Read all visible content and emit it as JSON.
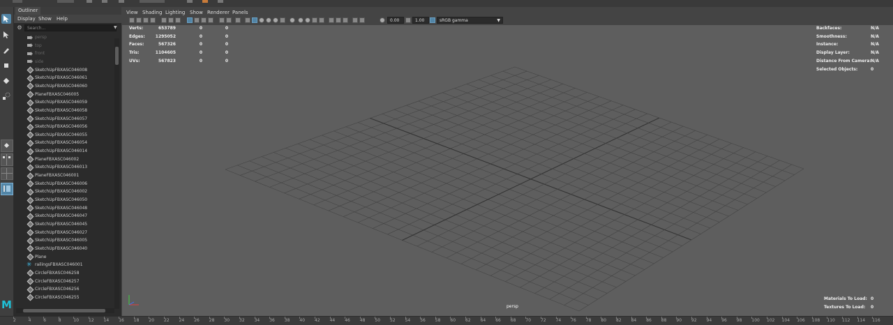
{
  "outliner": {
    "title": "Outliner",
    "menu": [
      "Display",
      "Show",
      "Help"
    ],
    "search_placeholder": "Search...",
    "items": [
      {
        "label": "persp",
        "icon": "camera-icon",
        "dim": true
      },
      {
        "label": "top",
        "icon": "camera-icon",
        "dim": true
      },
      {
        "label": "front",
        "icon": "camera-icon",
        "dim": true
      },
      {
        "label": "side",
        "icon": "camera-icon",
        "dim": true
      },
      {
        "label": "SketchUpFBXASC046008",
        "icon": "mesh-icon"
      },
      {
        "label": "SketchUpFBXASC046061",
        "icon": "mesh-icon"
      },
      {
        "label": "SketchUpFBXASC046060",
        "icon": "mesh-icon"
      },
      {
        "label": "PlaneFBXASC046005",
        "icon": "mesh-icon"
      },
      {
        "label": "SketchUpFBXASC046059",
        "icon": "mesh-icon"
      },
      {
        "label": "SketchUpFBXASC046058",
        "icon": "mesh-icon"
      },
      {
        "label": "SketchUpFBXASC046057",
        "icon": "mesh-icon"
      },
      {
        "label": "SketchUpFBXASC046056",
        "icon": "mesh-icon"
      },
      {
        "label": "SketchUpFBXASC046055",
        "icon": "mesh-icon"
      },
      {
        "label": "SketchUpFBXASC046054",
        "icon": "mesh-icon"
      },
      {
        "label": "SketchUpFBXASC046014",
        "icon": "mesh-icon"
      },
      {
        "label": "PlaneFBXASC046002",
        "icon": "mesh-icon"
      },
      {
        "label": "SketchUpFBXASC046013",
        "icon": "mesh-icon"
      },
      {
        "label": "PlaneFBXASC046001",
        "icon": "mesh-icon"
      },
      {
        "label": "SketchUpFBXASC046006",
        "icon": "mesh-icon"
      },
      {
        "label": "SketchUpFBXASC046002",
        "icon": "mesh-icon"
      },
      {
        "label": "SketchUpFBXASC046050",
        "icon": "mesh-icon"
      },
      {
        "label": "SketchUpFBXASC046048",
        "icon": "mesh-icon"
      },
      {
        "label": "SketchUpFBXASC046047",
        "icon": "mesh-icon"
      },
      {
        "label": "SketchUpFBXASC046045",
        "icon": "mesh-icon"
      },
      {
        "label": "SketchUpFBXASC046027",
        "icon": "mesh-icon"
      },
      {
        "label": "SketchUpFBXASC046005",
        "icon": "mesh-icon"
      },
      {
        "label": "SketchUpFBXASC046040",
        "icon": "mesh-icon"
      },
      {
        "label": "Plane",
        "icon": "mesh-icon"
      },
      {
        "label": "railingsFBXASC046001",
        "icon": "joint-icon"
      },
      {
        "label": "CircleFBXASC046258",
        "icon": "mesh-icon"
      },
      {
        "label": "CircleFBXASC046257",
        "icon": "mesh-icon"
      },
      {
        "label": "CircleFBXASC046256",
        "icon": "mesh-icon"
      },
      {
        "label": "CircleFBXASC046255",
        "icon": "mesh-icon"
      }
    ]
  },
  "viewport": {
    "menu": [
      "View",
      "Shading",
      "Lighting",
      "Show",
      "Renderer",
      "Panels"
    ],
    "exposure": "0.00",
    "gamma": "1.00",
    "color_space": "sRGB gamma",
    "camera_label": "persp",
    "stats": [
      {
        "label": "Verts:",
        "value": "653789",
        "sel": "0",
        "comp": "0"
      },
      {
        "label": "Edges:",
        "value": "1295052",
        "sel": "0",
        "comp": "0"
      },
      {
        "label": "Faces:",
        "value": "567326",
        "sel": "0",
        "comp": "0"
      },
      {
        "label": "Tris:",
        "value": "1104605",
        "sel": "0",
        "comp": "0"
      },
      {
        "label": "UVs:",
        "value": "567823",
        "sel": "0",
        "comp": "0"
      }
    ],
    "info": [
      {
        "label": "Backfaces:",
        "value": "N/A"
      },
      {
        "label": "Smoothness:",
        "value": "N/A"
      },
      {
        "label": "Instance:",
        "value": "N/A"
      },
      {
        "label": "Display Layer:",
        "value": "N/A"
      },
      {
        "label": "Distance From Camera:",
        "value": "N/A"
      },
      {
        "label": "Selected Objects:",
        "value": "0"
      }
    ],
    "load": [
      {
        "label": "Materials To Load:",
        "value": "0"
      },
      {
        "label": "Textures To Load:",
        "value": "0"
      }
    ]
  },
  "timeline": {
    "ticks": [
      "2",
      "4",
      "6",
      "8",
      "10",
      "12",
      "14",
      "16",
      "18",
      "20",
      "22",
      "24",
      "26",
      "28",
      "30",
      "32",
      "34",
      "36",
      "38",
      "40",
      "42",
      "44",
      "46",
      "48",
      "50",
      "52",
      "54",
      "56",
      "58",
      "60",
      "62",
      "64",
      "66",
      "68",
      "70",
      "72",
      "74",
      "76",
      "78",
      "80",
      "82",
      "84",
      "86",
      "88",
      "90",
      "92",
      "94",
      "96",
      "98",
      "100",
      "102",
      "104",
      "106",
      "108",
      "110",
      "112",
      "114",
      "116"
    ]
  },
  "colors": {
    "accent": "#5285a6",
    "viewport_bg": "#5e5e5e",
    "grid_line": "#444444",
    "maya_logo": "#1fc0d6"
  }
}
